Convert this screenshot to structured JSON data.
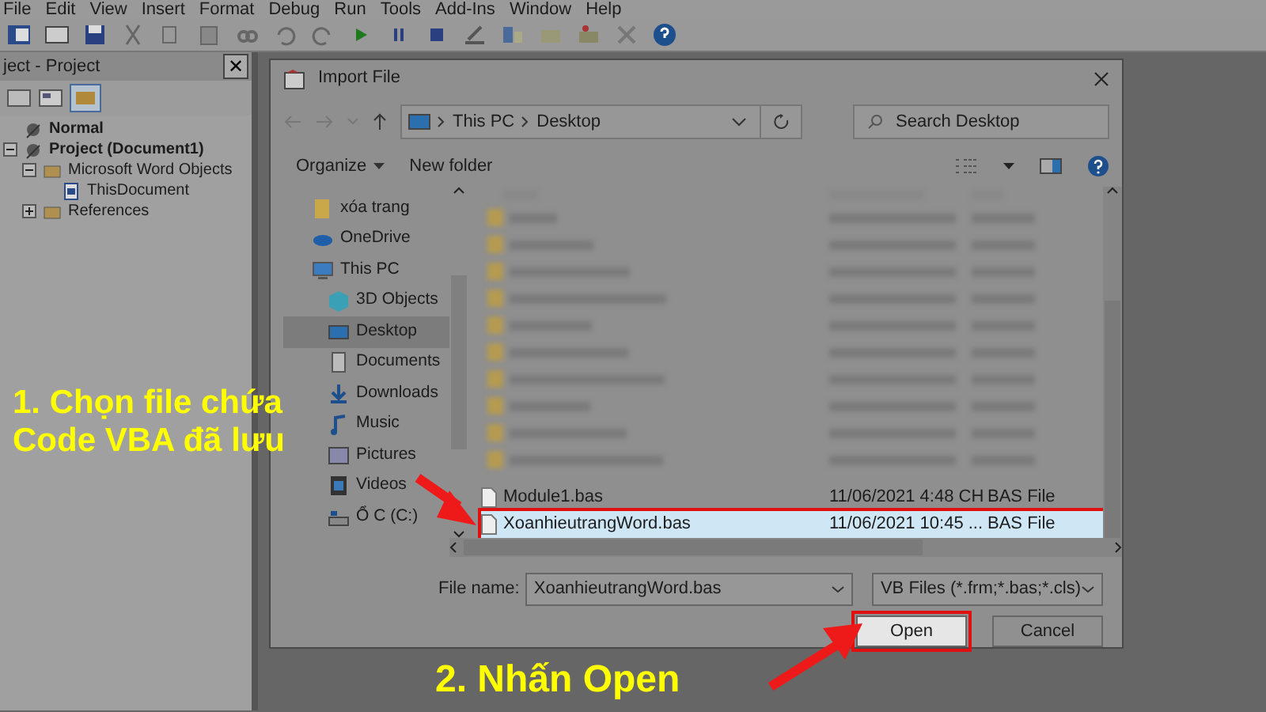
{
  "menu_bar": [
    "File",
    "Edit",
    "View",
    "Insert",
    "Format",
    "Debug",
    "Run",
    "Tools",
    "Add-Ins",
    "Window",
    "Help"
  ],
  "project_panel": {
    "title": "ject - Project",
    "close": "✕",
    "tree": [
      {
        "label": "Normal",
        "kind": "project"
      },
      {
        "label": "Project (Document1)",
        "kind": "project",
        "expanded": true,
        "children": [
          {
            "label": "Microsoft Word Objects",
            "kind": "folder",
            "expanded": true,
            "children": [
              {
                "label": "ThisDocument",
                "kind": "document"
              }
            ]
          },
          {
            "label": "References",
            "kind": "folder",
            "expanded": false
          }
        ]
      }
    ]
  },
  "dialog": {
    "title": "Import File",
    "address": [
      "This PC",
      "Desktop"
    ],
    "search": {
      "placeholder": "Search Desktop"
    },
    "commands": [
      "Organize",
      "New folder"
    ],
    "nav": [
      {
        "label": "xóa trang",
        "kind": "folder",
        "selected": false
      },
      {
        "label": "OneDrive",
        "kind": "cloud",
        "selected": false
      },
      {
        "label": "This PC",
        "kind": "pc",
        "selected": false
      },
      {
        "label": "3D Objects",
        "kind": "cube",
        "selected": false
      },
      {
        "label": "Desktop",
        "kind": "desktop",
        "selected": true
      },
      {
        "label": "Documents",
        "kind": "doc",
        "selected": false
      },
      {
        "label": "Downloads",
        "kind": "download",
        "selected": false
      },
      {
        "label": "Music",
        "kind": "music",
        "selected": false
      },
      {
        "label": "Pictures",
        "kind": "picture",
        "selected": false
      },
      {
        "label": "Videos",
        "kind": "video",
        "selected": false
      },
      {
        "label": "Ổ C (C:)",
        "kind": "drive",
        "selected": false
      }
    ],
    "files": [
      {
        "name": "Module1.bas",
        "date": "11/06/2021 4:48 CH",
        "type": "BAS File",
        "selected": false,
        "highlighted": false
      },
      {
        "name": "XoanhieutrangWord.bas",
        "date": "11/06/2021 10:45 ...",
        "type": "BAS File",
        "selected": true,
        "highlighted": true
      }
    ],
    "file_name_label": "File name:",
    "file_name": "XoanhieutrangWord.bas",
    "file_type": "VB Files (*.frm;*.bas;*.cls)",
    "buttons": [
      {
        "label": "Open",
        "highlighted": true
      },
      {
        "label": "Cancel",
        "highlighted": false
      }
    ]
  },
  "annotations": [
    {
      "text": "1. Chọn file chứa\nCode VBA đã lưu"
    },
    {
      "text": "2. Nhấn Open"
    }
  ]
}
